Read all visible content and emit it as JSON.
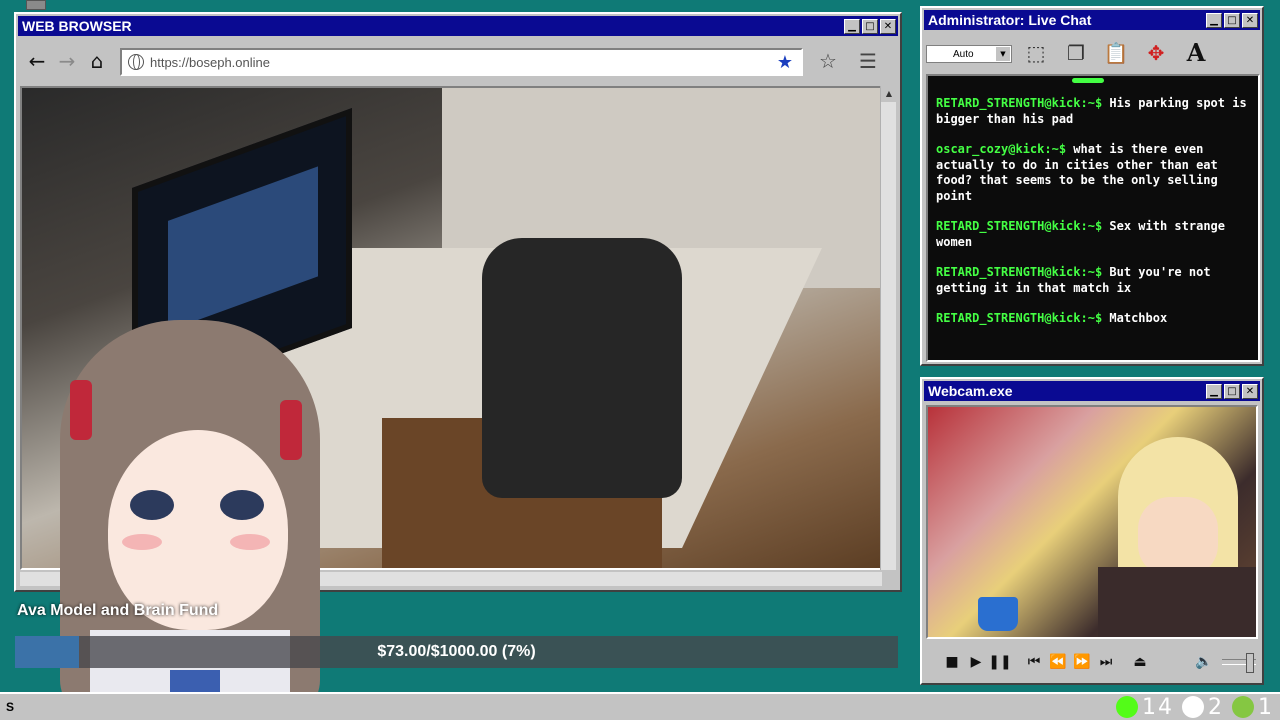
{
  "browser": {
    "title": "WEB BROWSER",
    "url": "https://boseph.online",
    "buttons": {
      "minimize": "▁",
      "maximize": "□",
      "close": "✕"
    }
  },
  "chat": {
    "title": "Administrator: Live Chat",
    "font_size_value": "Auto",
    "messages": [
      {
        "user": "RETARD_STRENGTH@kick:~$",
        "text": "His parking spot is bigger than his pad"
      },
      {
        "user": "oscar_cozy@kick:~$",
        "text": "what is there even actually to do in cities other than eat food? that seems to be the only selling point"
      },
      {
        "user": "RETARD_STRENGTH@kick:~$",
        "text": "Sex with strange women"
      },
      {
        "user": "RETARD_STRENGTH@kick:~$",
        "text": "But you're not getting it in that match ix"
      },
      {
        "user": "RETARD_STRENGTH@kick:~$",
        "text": "Matchbox"
      }
    ]
  },
  "webcam": {
    "title": "Webcam.exe"
  },
  "fund": {
    "label": "Ava Model and Brain Fund",
    "progress_text": "$73.00/$1000.00 (7%)",
    "progress_fraction": 0.073
  },
  "taskbar": {
    "start_label": "S",
    "tray": [
      {
        "icon": "kick-icon",
        "count": "14",
        "color": "#53fc18"
      },
      {
        "icon": "moon-icon",
        "count": "2",
        "color": "#ffffff"
      },
      {
        "icon": "rumble-icon",
        "count": "1",
        "color": "#85c742"
      }
    ]
  }
}
